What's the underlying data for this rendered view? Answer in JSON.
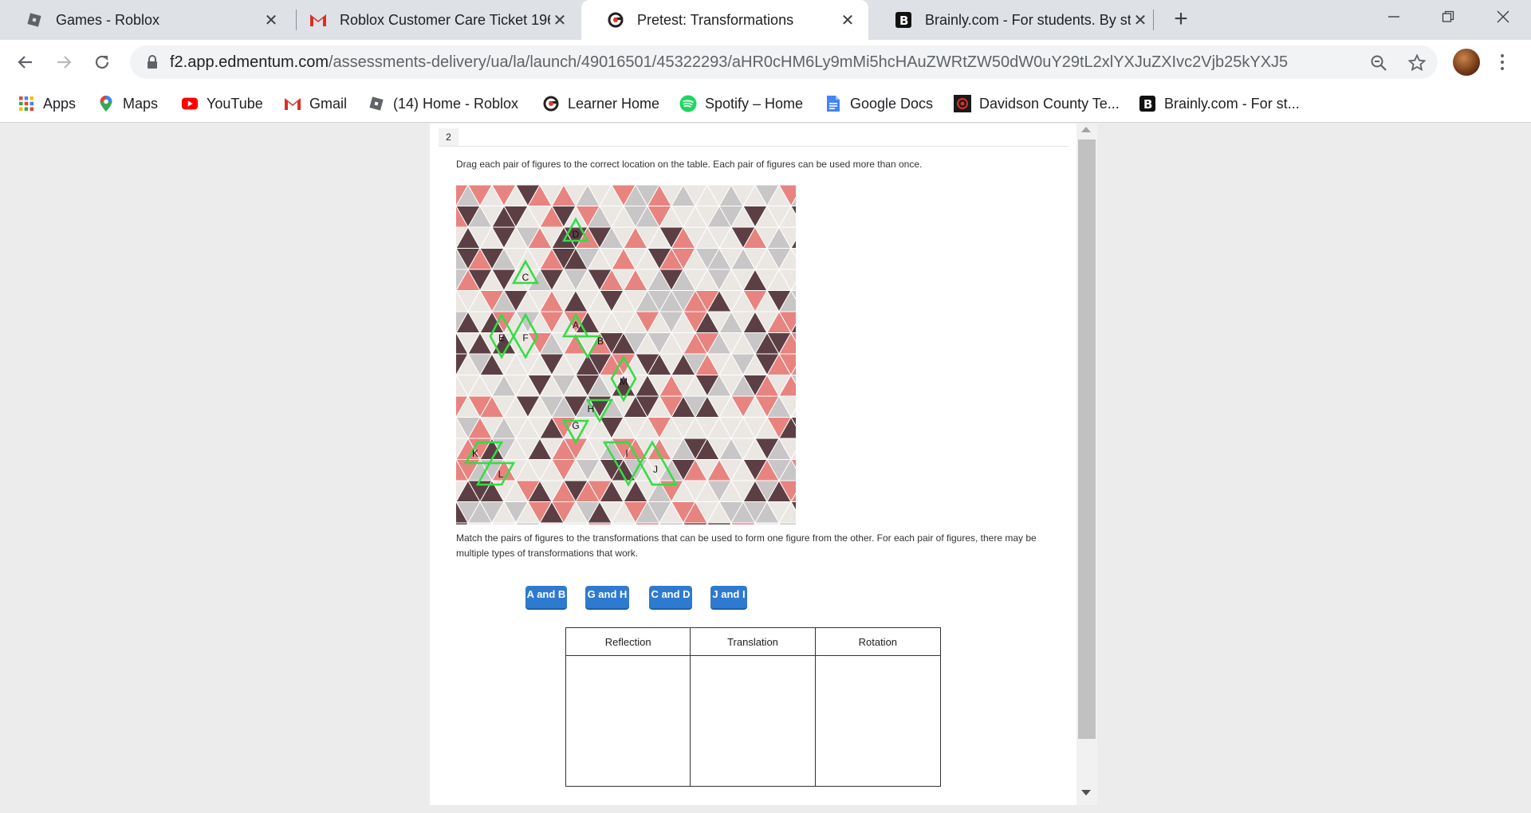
{
  "tabs": [
    {
      "title": "Games - Roblox",
      "icon": "roblox-icon",
      "active": false
    },
    {
      "title": "Roblox Customer Care Ticket 196",
      "icon": "gmail-icon",
      "active": false
    },
    {
      "title": "Pretest: Transformations",
      "icon": "edmentum-icon",
      "active": true
    },
    {
      "title": "Brainly.com - For students. By stu",
      "icon": "brainly-icon",
      "active": false
    }
  ],
  "new_tab_symbol": "+",
  "toolbar": {
    "url_host": "f2.app.edmentum.com",
    "url_path": "/assessments-delivery/ua/la/launch/49016501/45322293/aHR0cHM6Ly9mMi5hcHAuZWRtZW50dW0uY29tL2xlYXJuZXIvc2Vjb25kYXJ5"
  },
  "bookmarks": [
    {
      "label": "Apps",
      "icon": "apps-grid-icon"
    },
    {
      "label": "Maps",
      "icon": "maps-pin-icon"
    },
    {
      "label": "YouTube",
      "icon": "youtube-icon"
    },
    {
      "label": "Gmail",
      "icon": "gmail-icon"
    },
    {
      "label": "(14) Home - Roblox",
      "icon": "roblox-icon"
    },
    {
      "label": "Learner Home",
      "icon": "edmentum-icon"
    },
    {
      "label": "Spotify – Home",
      "icon": "spotify-icon"
    },
    {
      "label": "Google Docs",
      "icon": "google-docs-icon"
    },
    {
      "label": "Davidson County Te...",
      "icon": "davidson-icon"
    },
    {
      "label": "Brainly.com - For st...",
      "icon": "brainly-icon"
    }
  ],
  "question": {
    "number": "2",
    "instruction": "Drag each pair of figures to the correct location on the table. Each pair of figures can be used more than once.",
    "match_text": "Match the pairs of figures to the transformations that can be used to form one figure from the other. For each pair of figures, there may be multiple types of transformations that work.",
    "figure_labels": [
      "D",
      "C",
      "A",
      "E",
      "F",
      "B",
      "M",
      "H",
      "G",
      "K",
      "I",
      "J",
      "L"
    ],
    "chips": [
      "A and B",
      "G and H",
      "C and D",
      "J and I"
    ],
    "columns": [
      "Reflection",
      "Translation",
      "Rotation"
    ]
  },
  "colors": {
    "tri_dark": "#5c3f44",
    "tri_pink": "#e88480",
    "tri_gray": "#c8c6c6",
    "tri_light": "#ebe7e3",
    "highlight": "#33dd44",
    "chip": "#2f7ad1"
  }
}
